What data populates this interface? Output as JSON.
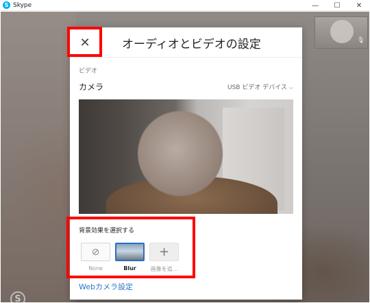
{
  "window": {
    "app_title": "Skype",
    "logo_letter": "S",
    "minimize_glyph": "—",
    "maximize_glyph": "☐",
    "close_glyph": "✕"
  },
  "call": {
    "mic_icon": "mic-muted-icon",
    "mic_glyph": "🎙",
    "watermark_letter": "S"
  },
  "dialog": {
    "title": "オーディオとビデオの設定",
    "close_glyph": "✕",
    "section_label": "ビデオ",
    "camera_label": "カメラ",
    "camera_device": "USB ビデオ デバイス",
    "camera_chevron": "⌵",
    "background_effects_label": "背景効果を選択する",
    "effects": [
      {
        "label": "None",
        "glyph": "⊘",
        "selected": false
      },
      {
        "label": "Blur",
        "glyph": "",
        "selected": true
      },
      {
        "label": "画像を追...",
        "glyph": "+",
        "selected": false
      }
    ],
    "webcam_settings_link": "Webカメラ設定"
  },
  "colors": {
    "accent": "#2a75c9",
    "highlight": "#ff0000",
    "skype_blue": "#00aff0"
  }
}
